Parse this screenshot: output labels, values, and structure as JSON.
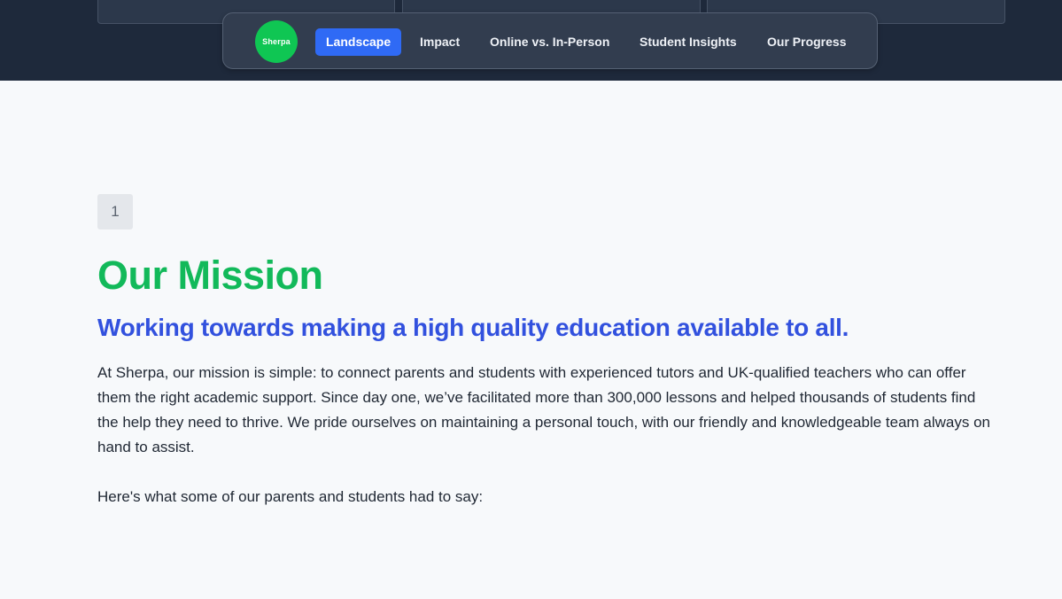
{
  "navbar": {
    "logo_text": "Sherpa",
    "items": [
      {
        "label": "Landscape",
        "active": true
      },
      {
        "label": "Impact",
        "active": false
      },
      {
        "label": "Online vs. In-Person",
        "active": false
      },
      {
        "label": "Student Insights",
        "active": false
      },
      {
        "label": "Our Progress",
        "active": false
      }
    ]
  },
  "section": {
    "step_number": "1",
    "title": "Our Mission",
    "subtitle": "Working towards making a high quality education available to all.",
    "body": "At Sherpa, our mission is simple: to connect parents and students with experienced tutors and UK-qualified teachers who can offer them the right academic support. Since day one, we’ve facilitated more than 300,000 lessons and helped thousands of students find the help they need to thrive. We pride ourselves on maintaining a personal touch, with our friendly and knowledgeable team always on hand to assist.",
    "testimonial_intro": "Here's what some of our parents and students had to say:"
  },
  "colors": {
    "header_background": "#1e293b",
    "accent_green": "#12b95a",
    "accent_blue": "#3251de",
    "nav_active": "#2f6af5"
  }
}
